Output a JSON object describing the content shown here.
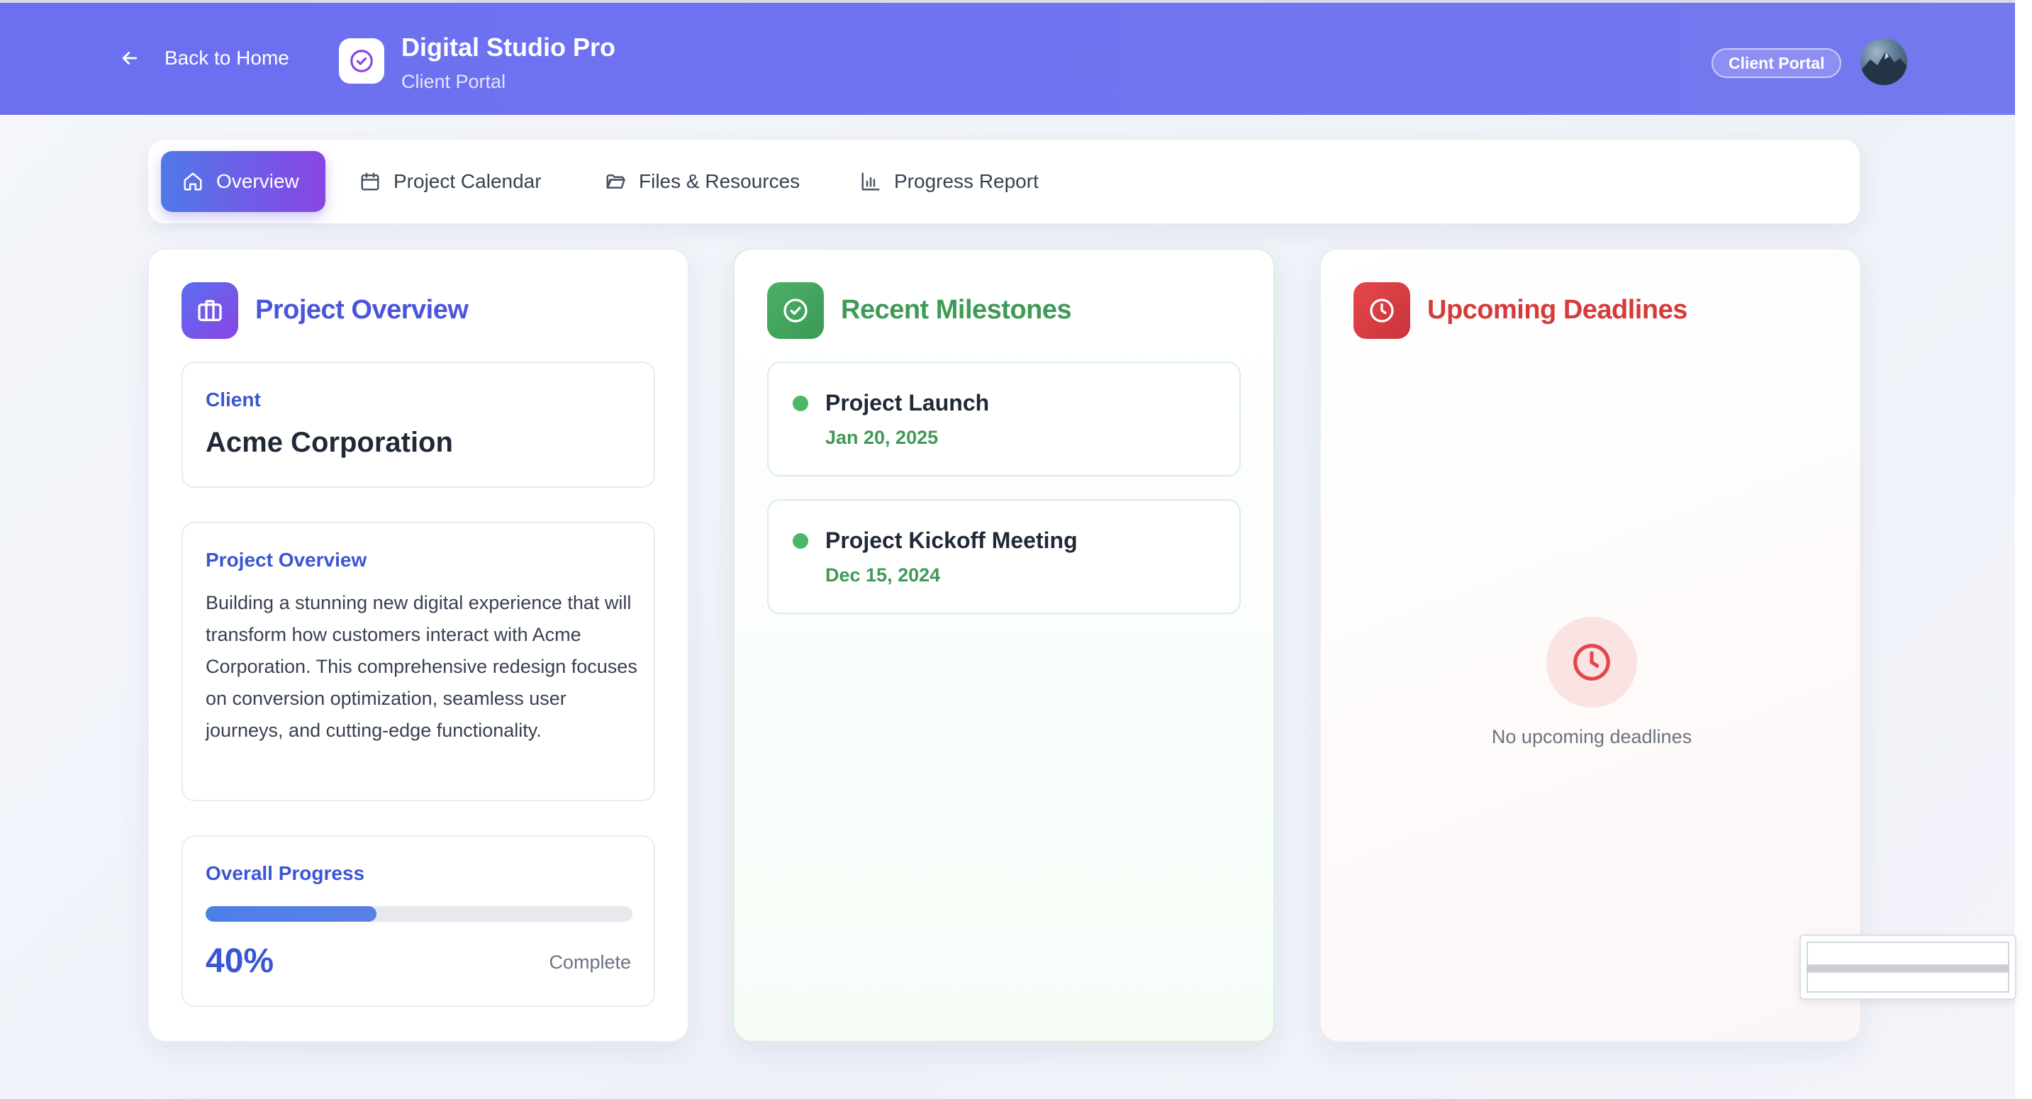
{
  "header": {
    "back_label": "Back to Home",
    "brand_title": "Digital Studio Pro",
    "brand_subtitle": "Client Portal",
    "portal_badge": "Client Portal",
    "avatar_icon": "user-avatar"
  },
  "tabs": [
    {
      "label": "Overview",
      "icon": "home-icon",
      "active": true
    },
    {
      "label": "Project Calendar",
      "icon": "calendar-icon",
      "active": false
    },
    {
      "label": "Files & Resources",
      "icon": "folder-icon",
      "active": false
    },
    {
      "label": "Progress Report",
      "icon": "bar-chart-icon",
      "active": false
    }
  ],
  "overview": {
    "title": "Project Overview",
    "client_label": "Client",
    "client_name": "Acme Corporation",
    "description_label": "Project Overview",
    "description": "Building a stunning new digital experience that will transform how customers interact with Acme Corporation. This comprehensive redesign focuses on conversion optimization, seamless user journeys, and cutting-edge functionality.",
    "progress_label": "Overall Progress",
    "progress_value": 40,
    "progress_text": "40%",
    "progress_status": "Complete"
  },
  "milestones": {
    "title": "Recent Milestones",
    "items": [
      {
        "title": "Project Launch",
        "date": "Jan 20, 2025"
      },
      {
        "title": "Project Kickoff Meeting",
        "date": "Dec 15, 2024"
      }
    ]
  },
  "deadlines": {
    "title": "Upcoming Deadlines",
    "empty_text": "No upcoming deadlines"
  },
  "colors": {
    "header": "#6b6ff0",
    "accent_blue": "#3a56d4",
    "milestone_green": "#3f9a56",
    "deadline_red": "#d63a3a"
  }
}
